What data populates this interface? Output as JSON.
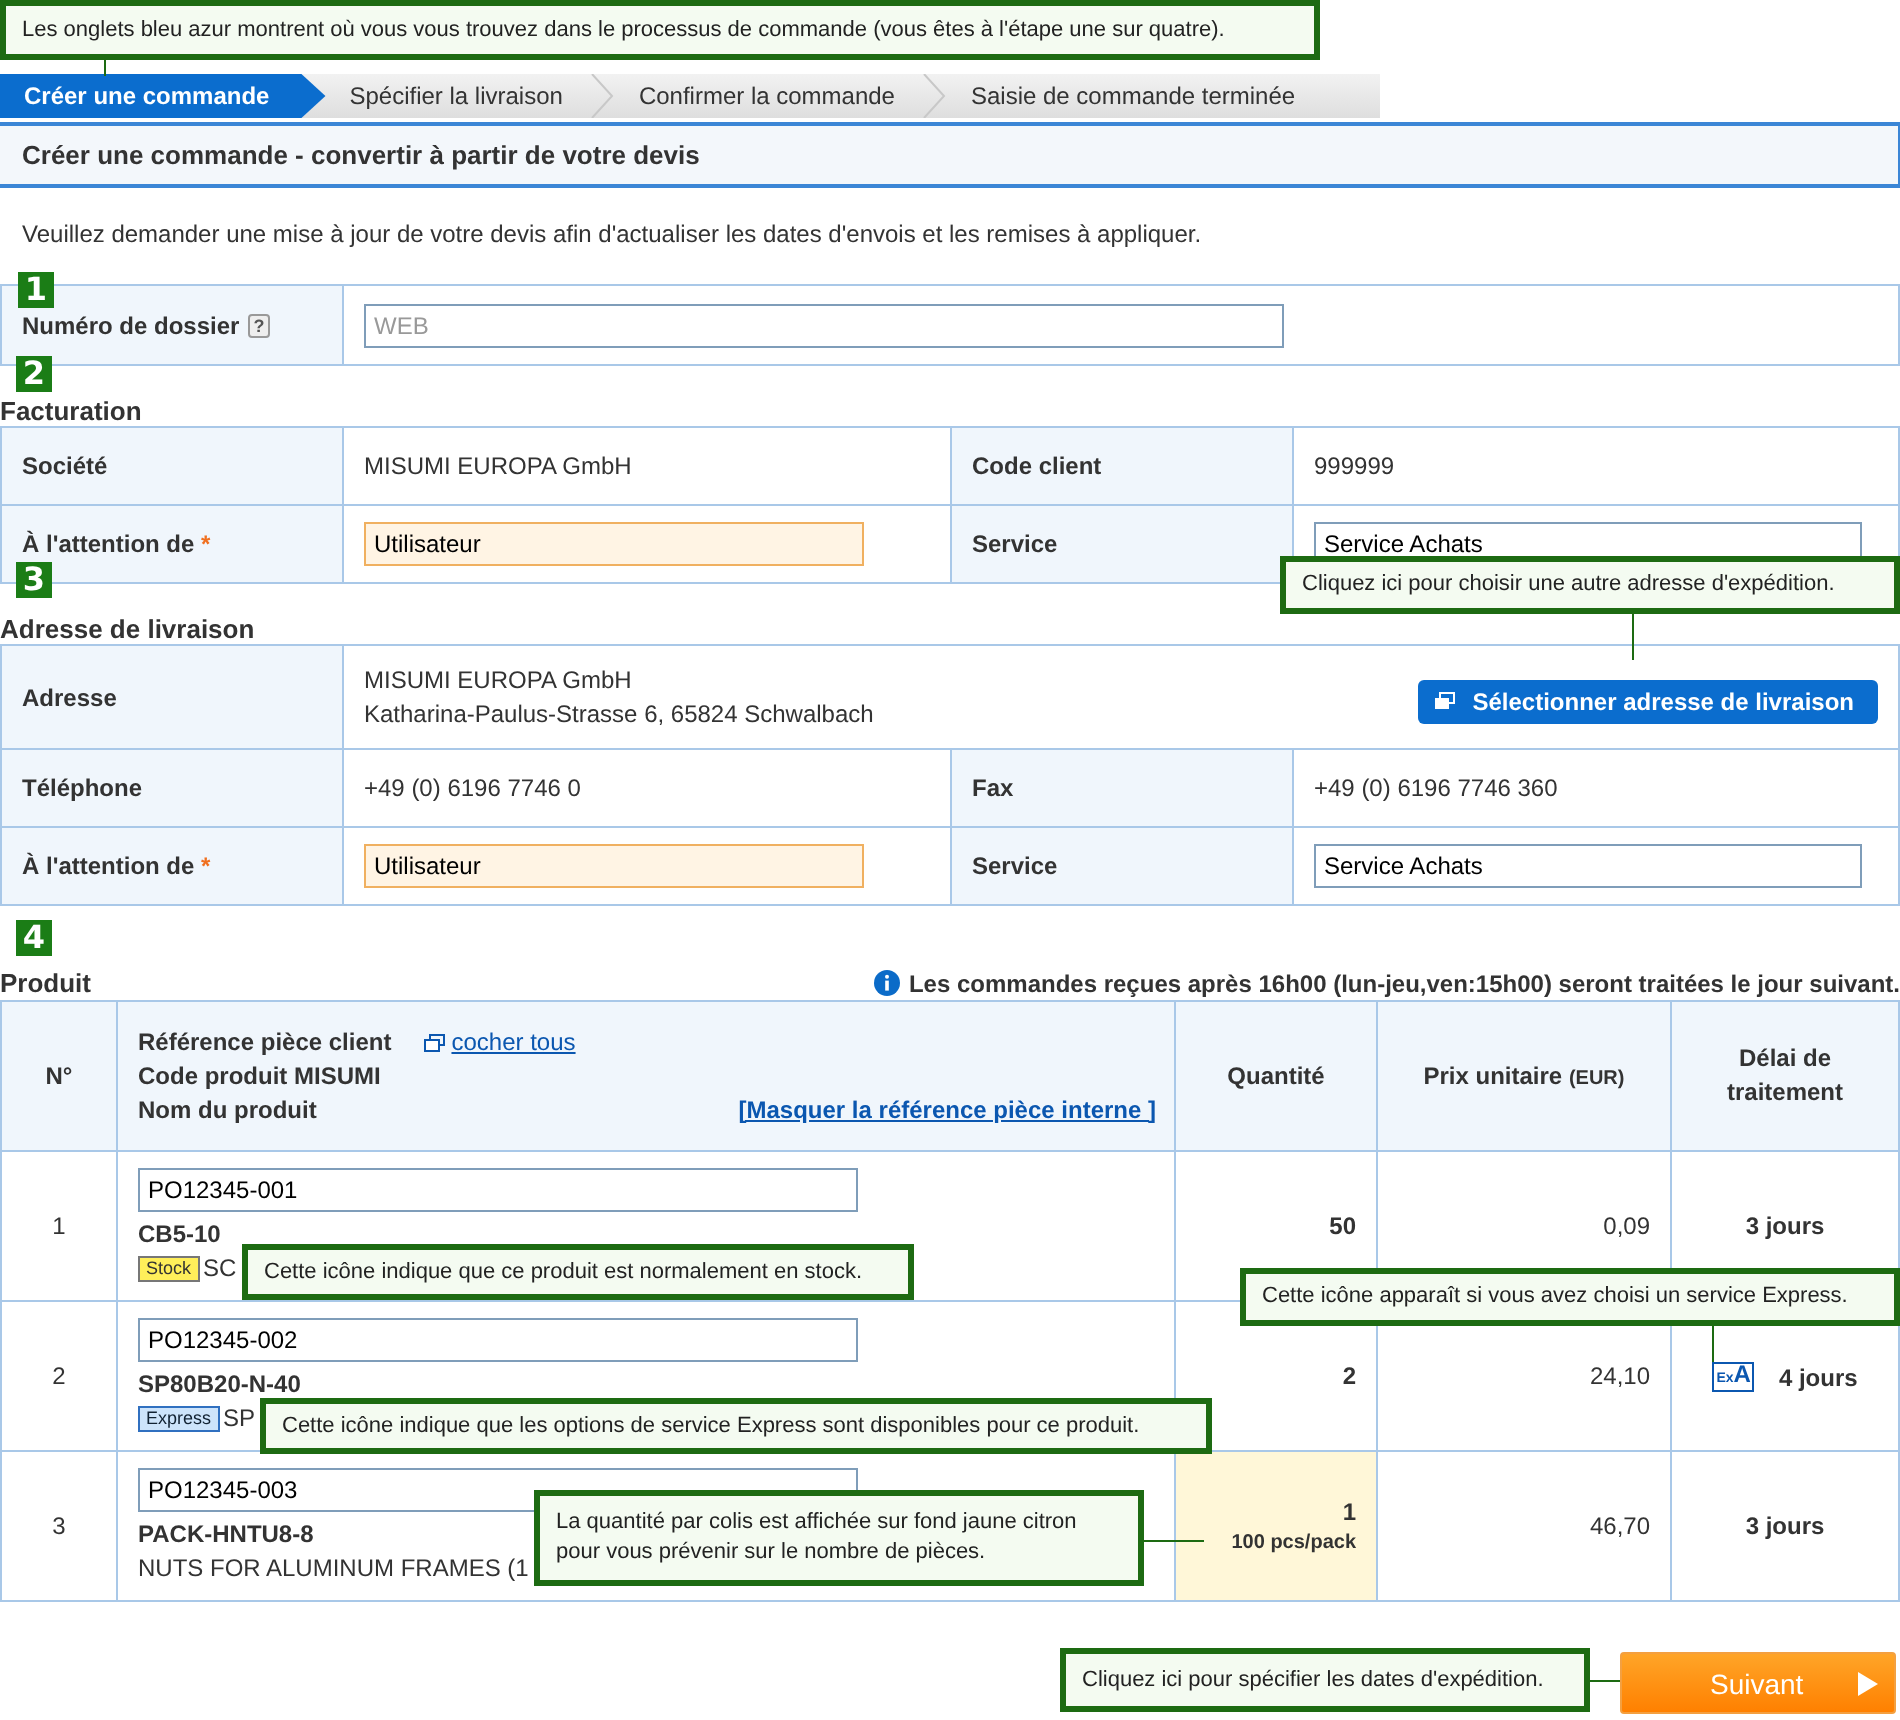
{
  "callouts": [
    {
      "text": "Les onglets bleu azur montrent où vous vous trouvez dans le processus de commande (vous êtes à l'étape une sur quatre)."
    },
    {
      "text": "Cliquez ici pour choisir une autre adresse d'expédition."
    },
    {
      "text": "Cette icône indique que ce produit est normalement en stock."
    },
    {
      "text": "Cette icône apparaît si vous avez choisi un service Express."
    },
    {
      "text": "Cette icône indique que les options de service Express sont disponibles pour ce produit."
    },
    {
      "text": "La quantité par colis est affichée sur fond jaune citron pour vous prévenir sur le nombre de pièces."
    },
    {
      "text": "Cliquez ici pour spécifier les dates d'expédition."
    }
  ],
  "steps": [
    {
      "label": "Créer une commande",
      "selected": true
    },
    {
      "label": "Spécifier la livraison",
      "selected": false
    },
    {
      "label": "Confirmer la commande",
      "selected": false
    },
    {
      "label": "Saisie de commande terminée",
      "selected": false
    }
  ],
  "page_title": "Créer une commande - convertir à partir de votre devis",
  "intro": "Veuillez demander une mise à jour de votre devis afin d'actualiser les dates d'envois et les remises à appliquer.",
  "dossier": {
    "marker": "1",
    "label": "Numéro de dossier",
    "help": "?",
    "placeholder": "WEB"
  },
  "billing": {
    "marker": "2",
    "title": "Facturation",
    "rows": [
      [
        {
          "kind": "label",
          "text": "Société"
        },
        {
          "kind": "text",
          "text": "MISUMI EUROPA GmbH"
        },
        {
          "kind": "label",
          "text": "Code client"
        },
        {
          "kind": "text",
          "text": "999999"
        }
      ],
      [
        {
          "kind": "label",
          "text": "À l'attention de",
          "required_mark": "*"
        },
        {
          "kind": "input",
          "value": "Utilisateur",
          "required": true
        },
        {
          "kind": "label",
          "text": "Service"
        },
        {
          "kind": "input",
          "value": "Service Achats",
          "required": false
        }
      ]
    ]
  },
  "shipping": {
    "marker": "3",
    "title": "Adresse de livraison",
    "rows": [
      [
        {
          "kind": "label",
          "text": "Adresse"
        },
        {
          "kind": "address",
          "lines": [
            "MISUMI EUROPA GmbH",
            "Katharina-Paulus-Strasse 6, 65824 Schwalbach"
          ],
          "button": "Sélectionner adresse de livraison"
        }
      ],
      [
        {
          "kind": "label",
          "text": "Téléphone"
        },
        {
          "kind": "text",
          "text": "+49 (0) 6196 7746 0"
        },
        {
          "kind": "label",
          "text": "Fax"
        },
        {
          "kind": "text",
          "text": "+49 (0) 6196 7746 360"
        }
      ],
      [
        {
          "kind": "label",
          "text": "À l'attention de",
          "required_mark": "*"
        },
        {
          "kind": "input",
          "value": "Utilisateur",
          "required": true
        },
        {
          "kind": "label",
          "text": "Service"
        },
        {
          "kind": "input",
          "value": "Service Achats",
          "required": false
        }
      ]
    ]
  },
  "products": {
    "marker": "4",
    "title": "Produit",
    "notice": "Les commandes reçues après 16h00 (lun-jeu,ven:15h00) seront traitées le jour suivant.",
    "columns": {
      "number": "N°",
      "ref": "Référence pièce client",
      "check_all": "cocher tous",
      "code": "Code produit MISUMI",
      "name": "Nom du produit",
      "hide_ref": "[Masquer la référence pièce interne ]",
      "quantity": "Quantité",
      "price": "Prix unitaire",
      "currency": "(EUR)",
      "delay": "Délai de traitement"
    },
    "rows": [
      {
        "number": "1",
        "ref": "PO12345-001",
        "code": "CB5-10",
        "badge": {
          "kind": "stock",
          "label": "Stock"
        },
        "name": "SC",
        "quantity": "50",
        "price": "0,09",
        "delay": "3 jours"
      },
      {
        "number": "2",
        "ref": "PO12345-002",
        "code": "SP80B20-N-40",
        "badge": {
          "kind": "express",
          "label": "Express"
        },
        "name": "SP",
        "quantity": "2",
        "price": "24,10",
        "delay": "4 jours",
        "express_mark": {
          "small": "Ex",
          "large": "A"
        }
      },
      {
        "number": "3",
        "ref": "PO12345-003",
        "code": "PACK-HNTU8-8",
        "name": "NUTS FOR ALUMINUM FRAMES (1",
        "quantity": "1",
        "pack": "100 pcs/pack",
        "price": "46,70",
        "delay": "3 jours"
      }
    ]
  },
  "next_button": "Suivant"
}
